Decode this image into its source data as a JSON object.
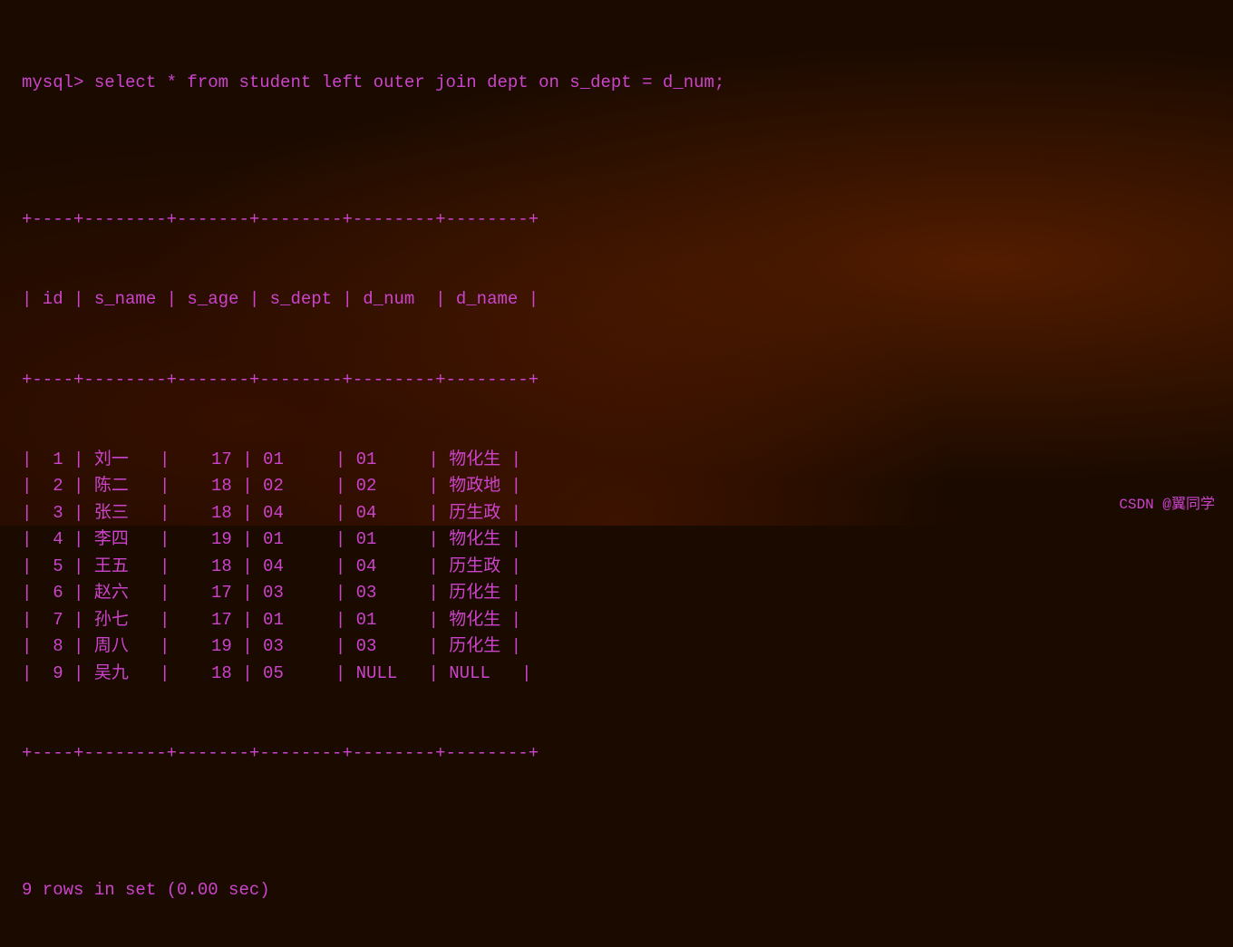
{
  "terminal": {
    "command": "mysql> select * from student left outer join dept on s_dept = d_num;",
    "border_top": "+----+--------+-------+--------+--------+--------+",
    "header": "| id | s_name | s_age | s_dept | d_num  | d_name |",
    "border_mid": "+----+--------+-------+--------+--------+--------+",
    "rows": [
      "|  1 | 刘一   |    17 | 01     | 01     | 物化生 |",
      "|  2 | 陈二   |    18 | 02     | 02     | 物政地 |",
      "|  3 | 张三   |    18 | 04     | 04     | 历生政 |",
      "|  4 | 李四   |    19 | 01     | 01     | 物化生 |",
      "|  5 | 王五   |    18 | 04     | 04     | 历生政 |",
      "|  6 | 赵六   |    17 | 03     | 03     | 历化生 |",
      "|  7 | 孙七   |    17 | 01     | 01     | 物化生 |",
      "|  8 | 周八   |    19 | 03     | 03     | 历化生 |",
      "|  9 | 吴九   |    18 | 05     | NULL   | NULL   |"
    ],
    "border_bottom": "+----+--------+-------+--------+--------+--------+",
    "footer": "9 rows in set (0.00 sec)",
    "watermark": "CSDN @翼同学"
  }
}
